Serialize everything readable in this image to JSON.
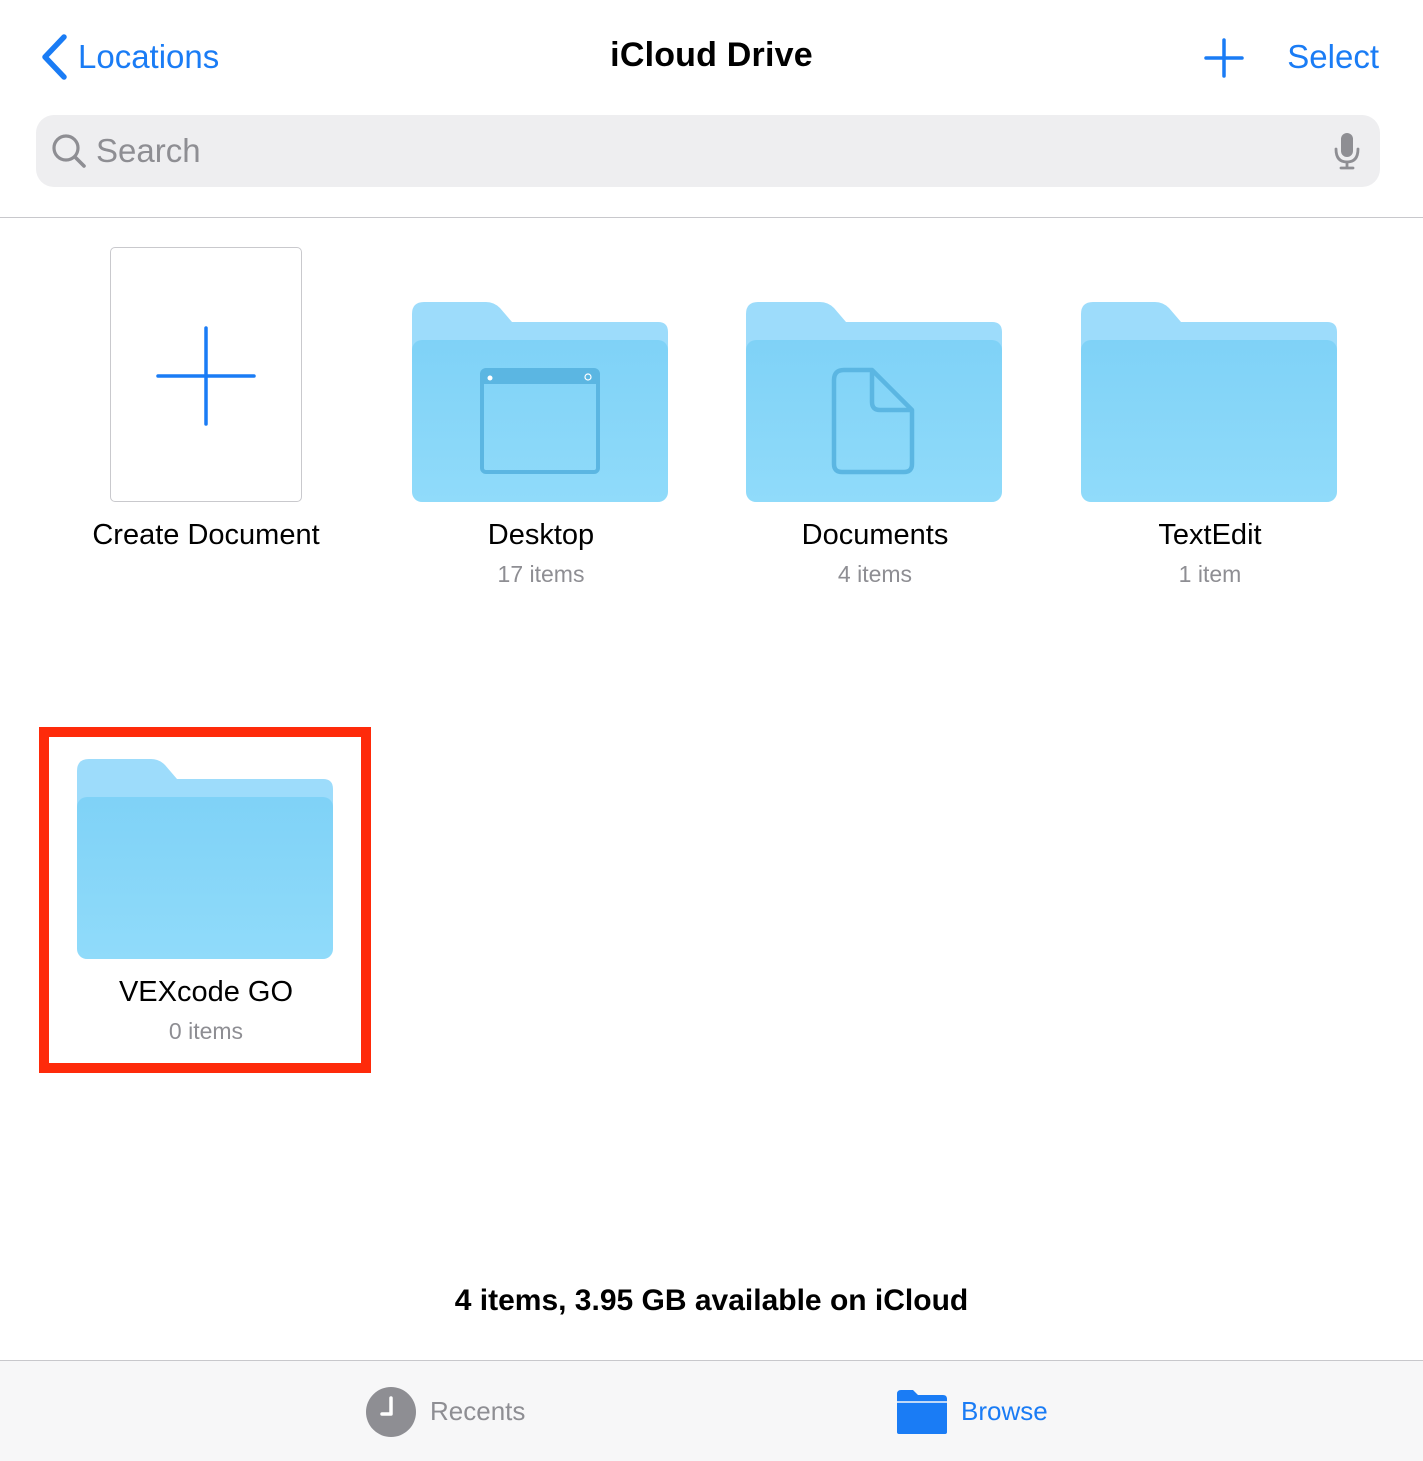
{
  "nav": {
    "back_label": "Locations",
    "title": "iCloud Drive",
    "add_icon": "plus-icon",
    "select_label": "Select"
  },
  "search": {
    "placeholder": "Search",
    "value": ""
  },
  "items": [
    {
      "name": "Create Document",
      "icon": "plus-icon"
    },
    {
      "name": "Desktop",
      "count": "17 items",
      "icon": "desktop-folder-icon"
    },
    {
      "name": "Documents",
      "count": "4 items",
      "icon": "documents-folder-icon"
    },
    {
      "name": "TextEdit",
      "count": "1 item",
      "icon": "folder-icon"
    },
    {
      "name": "VEXcode GO",
      "count": "0 items",
      "icon": "folder-icon",
      "highlighted": true
    }
  ],
  "footer": {
    "summary": "4 items, 3.95 GB available on iCloud"
  },
  "tabbar": {
    "tabs": [
      {
        "label": "Recents",
        "icon": "clock-icon",
        "active": false
      },
      {
        "label": "Browse",
        "icon": "folder-icon",
        "active": true
      }
    ]
  },
  "colors": {
    "accent": "#1a7cf5",
    "folder_light": "#9ddcfb",
    "folder_body": "#84d4f8",
    "highlight": "#fe2a0a",
    "secondary_text": "#8e8e93"
  }
}
